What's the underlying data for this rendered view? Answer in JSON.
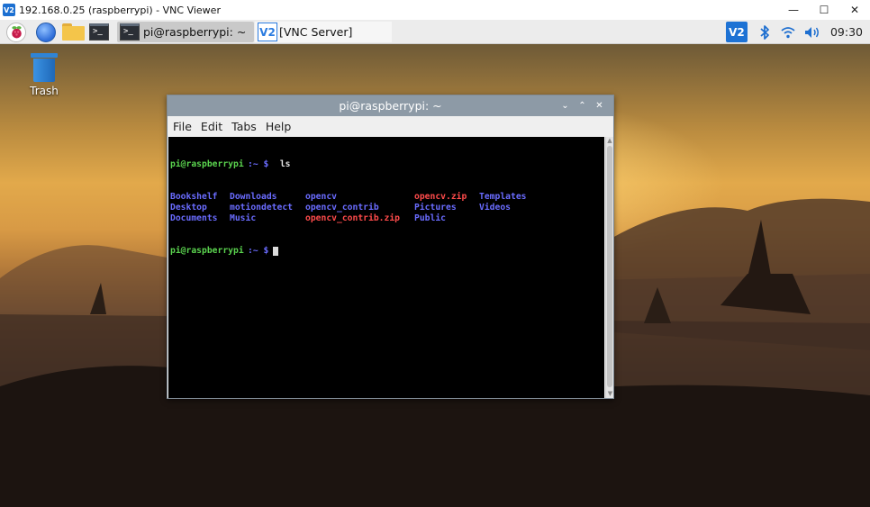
{
  "viewer": {
    "logo": "V2",
    "title": "192.168.0.25 (raspberrypi) - VNC Viewer",
    "minimize": "—",
    "maximize": "☐",
    "close": "✕"
  },
  "panel": {
    "launchers": [
      "raspberry-menu-icon",
      "web-browser-icon",
      "file-manager-icon",
      "terminal-icon"
    ],
    "tasks": [
      {
        "label": "pi@raspberrypi: ~",
        "icon": "terminal-icon",
        "active": true
      },
      {
        "label": "[VNC Server]",
        "icon": "vnc-server-icon",
        "active": false
      }
    ],
    "tray": {
      "vnc_label": "V2",
      "icons": [
        "vnc-icon",
        "bluetooth-icon",
        "wifi-icon",
        "volume-icon"
      ],
      "clock": "09:30"
    }
  },
  "desktop": {
    "trash_label": "Trash"
  },
  "terminal": {
    "title": "pi@raspberrypi: ~",
    "controls": [
      "⌄",
      "⌃",
      "✕"
    ],
    "menu": [
      "File",
      "Edit",
      "Tabs",
      "Help"
    ],
    "prompt_user": "pi@raspberrypi",
    "prompt_path": ":~ $",
    "command": " ls",
    "ls_columns": [
      [
        {
          "name": "Bookshelf",
          "kind": "dir"
        },
        {
          "name": "Desktop",
          "kind": "dir"
        },
        {
          "name": "Documents",
          "kind": "dir"
        }
      ],
      [
        {
          "name": "Downloads",
          "kind": "dir"
        },
        {
          "name": "motiondetect",
          "kind": "dir"
        },
        {
          "name": "Music",
          "kind": "dir"
        }
      ],
      [
        {
          "name": "opencv",
          "kind": "dir"
        },
        {
          "name": "opencv_contrib",
          "kind": "dir"
        },
        {
          "name": "opencv_contrib.zip",
          "kind": "zip"
        }
      ],
      [
        {
          "name": "opencv.zip",
          "kind": "zip"
        },
        {
          "name": "Pictures",
          "kind": "dir"
        },
        {
          "name": "Public",
          "kind": "dir"
        }
      ],
      [
        {
          "name": "Templates",
          "kind": "dir"
        },
        {
          "name": "Videos",
          "kind": "dir"
        }
      ]
    ],
    "colors": {
      "prompt": "#5bd44f",
      "dir": "#6a6cff",
      "zip": "#ff4b4b"
    }
  }
}
